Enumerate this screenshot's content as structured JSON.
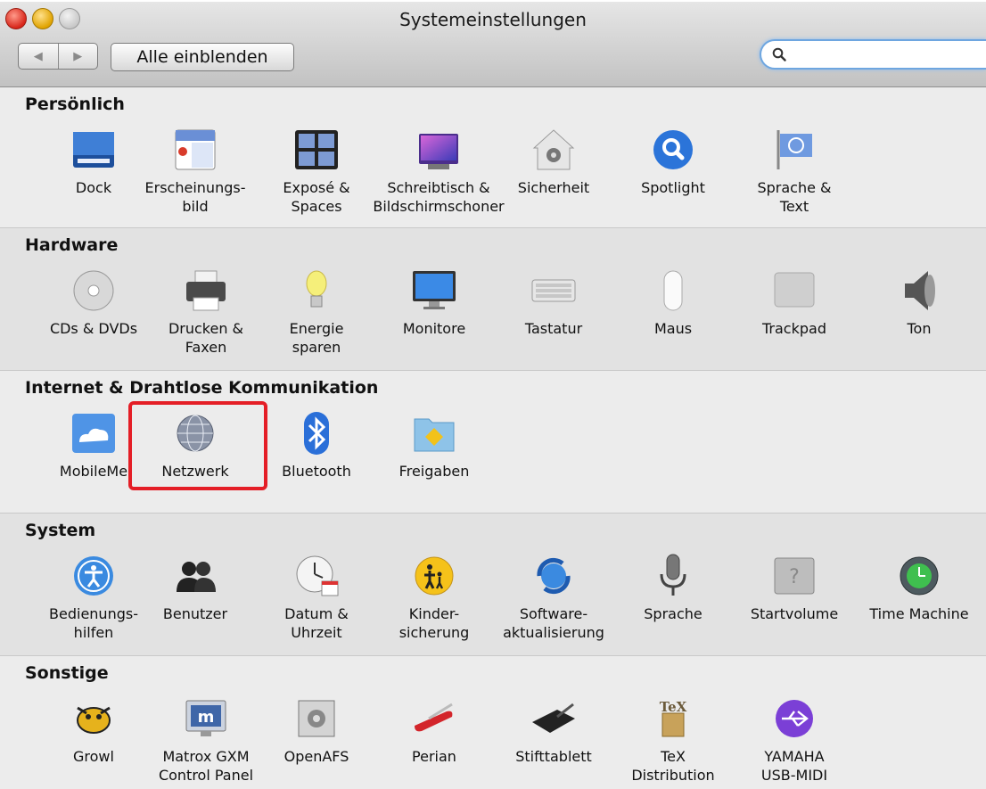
{
  "window": {
    "title": "Systemeinstellungen",
    "show_all_label": "Alle einblenden",
    "back_label": "◀",
    "forward_label": "▶",
    "search_placeholder": ""
  },
  "sections": {
    "personal": {
      "title": "Persönlich",
      "items": [
        "Dock",
        "Erscheinungs-\nbild",
        "Exposé &\nSpaces",
        "Schreibtisch &\nBildschirmschoner",
        "Sicherheit",
        "Spotlight",
        "Sprache &\nText"
      ]
    },
    "hardware": {
      "title": "Hardware",
      "items": [
        "CDs & DVDs",
        "Drucken &\nFaxen",
        "Energie\nsparen",
        "Monitore",
        "Tastatur",
        "Maus",
        "Trackpad",
        "Ton"
      ]
    },
    "internet": {
      "title": "Internet & Drahtlose Kommunikation",
      "items": [
        "MobileMe",
        "Netzwerk",
        "Bluetooth",
        "Freigaben"
      ]
    },
    "system": {
      "title": "System",
      "items": [
        "Bedienungs-\nhilfen",
        "Benutzer",
        "Datum &\nUhrzeit",
        "Kinder-\nsicherung",
        "Software-\naktualisierung",
        "Sprache",
        "Startvolume",
        "Time Machine"
      ]
    },
    "other": {
      "title": "Sonstige",
      "items": [
        "Growl",
        "Matrox GXM\nControl Panel",
        "OpenAFS",
        "Perian",
        "Stifttablett",
        "TeX\nDistribution",
        "YAMAHA\nUSB-MIDI"
      ]
    }
  },
  "icons": {
    "dock": "dock-icon",
    "appearance": "appearance-icon",
    "expose": "expose-icon",
    "desktop": "desktop-icon",
    "security": "security-icon",
    "spotlight": "spotlight-icon",
    "language": "language-icon"
  },
  "colors": {
    "highlight": "#e41e26",
    "accent_blue": "#2b74d9"
  }
}
